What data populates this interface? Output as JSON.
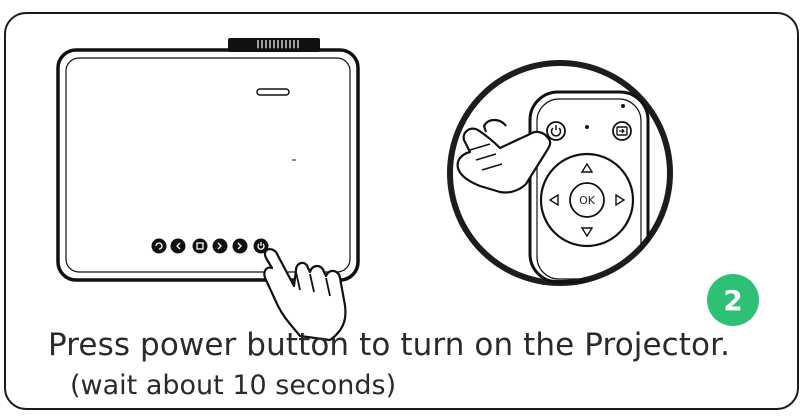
{
  "step": {
    "number": "2",
    "badge_color": "#2ec074"
  },
  "remote": {
    "ok_label": "OK"
  },
  "caption": {
    "line1": "Press power button to turn on the Projector.",
    "line2": "(wait about 10 seconds)"
  },
  "icons": [
    "projector",
    "remote-control",
    "power-button",
    "hand-pointer",
    "dpad"
  ]
}
